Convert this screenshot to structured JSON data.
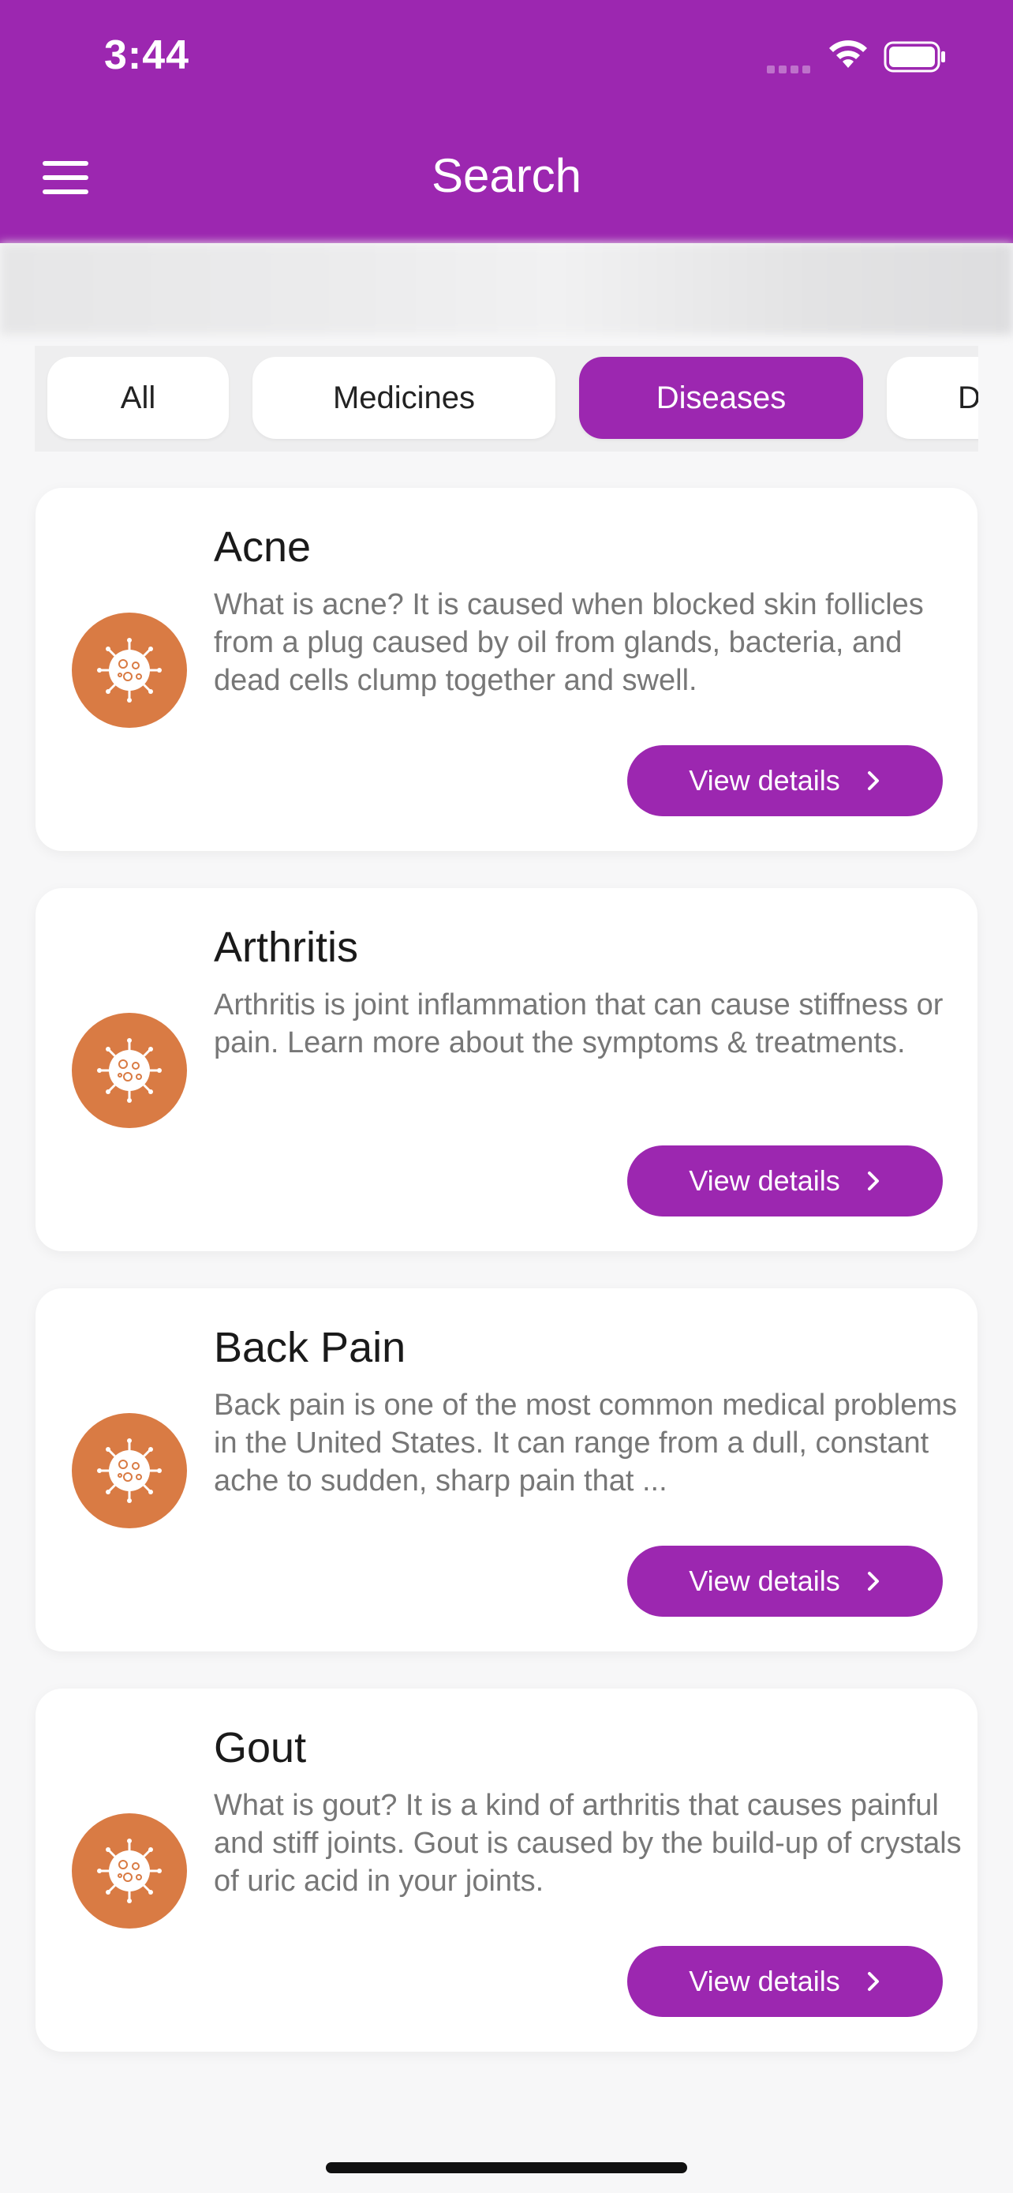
{
  "status_bar": {
    "time": "3:44"
  },
  "header": {
    "title": "Search"
  },
  "filters": {
    "chips": [
      {
        "label": "All",
        "active": false
      },
      {
        "label": "Medicines",
        "active": false
      },
      {
        "label": "Diseases",
        "active": true
      },
      {
        "label": "D",
        "active": false
      }
    ]
  },
  "results": [
    {
      "title": "Acne",
      "description": "What is acne? It is caused when blocked skin follicles from a plug caused by oil from glands, bacteria, and dead cells clump together and swell.",
      "button_label": "View details",
      "icon": "virus-icon"
    },
    {
      "title": "Arthritis",
      "description": "Arthritis is joint inflammation that can cause stiffness or pain. Learn more about the symptoms & treatments.",
      "button_label": "View details",
      "icon": "virus-icon"
    },
    {
      "title": "Back Pain",
      "description": "Back pain is one of the most common medical problems in the United States. It can range from a dull, constant ache to sudden, sharp pain that ...",
      "button_label": "View details",
      "icon": "virus-icon"
    },
    {
      "title": "Gout",
      "description": "What is gout? It is a kind of arthritis that causes painful and stiff joints. Gout is caused by the build-up of crystals of uric acid in your joints.",
      "button_label": "View details",
      "icon": "virus-icon"
    }
  ],
  "colors": {
    "brand": "#9c27b0",
    "icon_background": "#d97b44",
    "page_background": "#f7f7f8"
  }
}
